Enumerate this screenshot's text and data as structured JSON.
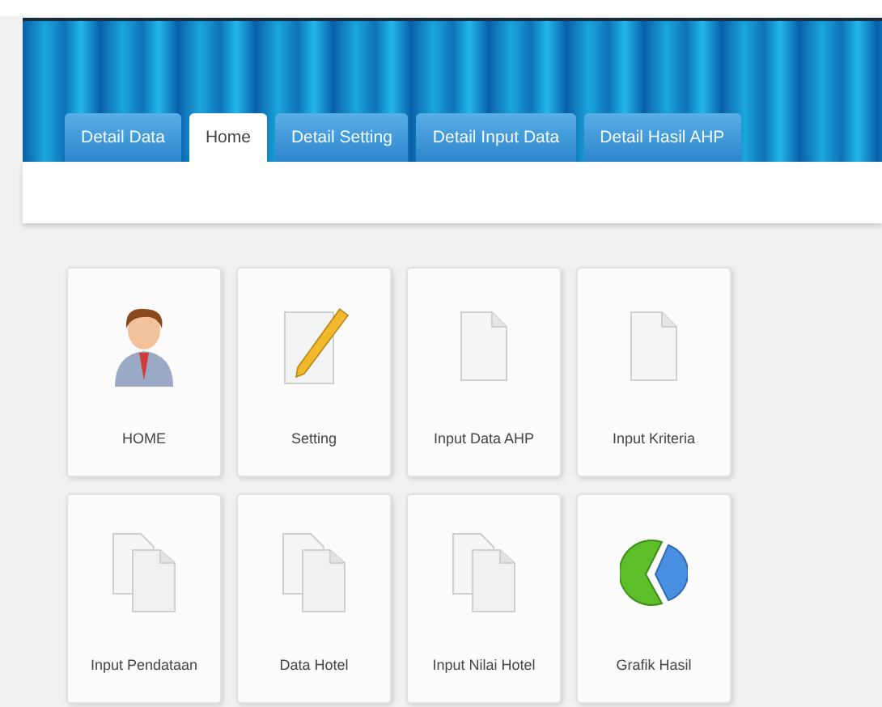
{
  "tabs": [
    {
      "label": "Detail Data",
      "selected": false
    },
    {
      "label": "Home",
      "selected": true
    },
    {
      "label": "Detail Setting",
      "selected": false
    },
    {
      "label": "Detail Input Data",
      "selected": false
    },
    {
      "label": "Detail Hasil AHP",
      "selected": false
    }
  ],
  "tiles": [
    {
      "label": "HOME",
      "kind": "user"
    },
    {
      "label": "Setting",
      "kind": "edit"
    },
    {
      "label": "Input Data AHP",
      "kind": "document"
    },
    {
      "label": "Input Kriteria",
      "kind": "document"
    },
    {
      "label": "Input Pendataan",
      "kind": "documents"
    },
    {
      "label": "Data Hotel",
      "kind": "documents"
    },
    {
      "label": "Input Nilai Hotel",
      "kind": "documents"
    },
    {
      "label": "Grafik Hasil",
      "kind": "chart"
    }
  ]
}
